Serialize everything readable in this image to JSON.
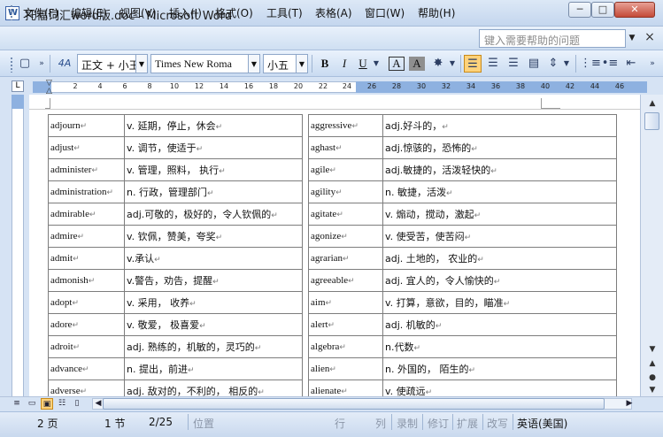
{
  "window": {
    "title": "托福词汇word版.doc - Microsoft Word",
    "minimize_glyph": "─",
    "maximize_glyph": "□",
    "close_glyph": "✕"
  },
  "menu": {
    "items": [
      "文件(F)",
      "编辑(E)",
      "视图(V)",
      "插入(I)",
      "格式(O)",
      "工具(T)",
      "表格(A)",
      "窗口(W)",
      "帮助(H)"
    ],
    "help_placeholder": "键入需要帮助的问题",
    "close_doc_glyph": "×"
  },
  "toolbar": {
    "style_value": "正文 + 小王",
    "font_value": "Times New Roma",
    "size_value": "小五",
    "bold": "B",
    "italic": "I",
    "underline": "U",
    "char_border": "A",
    "char_shade": "A",
    "styles_icon_text": "4A"
  },
  "ruler": {
    "ticks": [
      "2",
      "4",
      "6",
      "8",
      "10",
      "12",
      "14",
      "16",
      "18",
      "20",
      "22",
      "24",
      "26",
      "28",
      "30",
      "32",
      "34",
      "36",
      "38",
      "40",
      "42",
      "44",
      "46"
    ],
    "tab_selector": "L"
  },
  "table": {
    "rows": [
      {
        "word1": "adjourn",
        "def1": "v. 延期，停止，休会",
        "word2": "aggressive",
        "def2": "adj.好斗的，"
      },
      {
        "word1": "adjust",
        "def1": "v. 调节，使适于",
        "word2": "aghast",
        "def2": "adj.惊骇的，恐怖的"
      },
      {
        "word1": "administer",
        "def1": "v. 管理，照料，  执行",
        "word2": "agile",
        "def2": "adj.敏捷的，活泼轻快的"
      },
      {
        "word1": "administration",
        "def1": "n. 行政，管理部门",
        "word2": "agility",
        "def2": "n. 敏捷，活泼"
      },
      {
        "word1": "admirable",
        "def1": "adj.可敬的，极好的，令人钦佩的",
        "word2": "agitate",
        "def2": "v. 煽动，搅动，激起"
      },
      {
        "word1": "admire",
        "def1": "v. 钦佩，赞美，夸奖",
        "word2": "agonize",
        "def2": "v. 使受苦，使苦闷"
      },
      {
        "word1": "admit",
        "def1": "v.承认",
        "word2": "agrarian",
        "def2": "adj. 土地的，  农业的"
      },
      {
        "word1": "admonish",
        "def1": "v.警告，劝告，提醒",
        "word2": "agreeable",
        "def2": "adj. 宜人的，令人愉快的"
      },
      {
        "word1": "adopt",
        "def1": "v. 采用，  收养",
        "word2": "aim",
        "def2": "v. 打算，意欲，目的，瞄准"
      },
      {
        "word1": "adore",
        "def1": "v. 敬爱，  极喜爱",
        "word2": "alert",
        "def2": "adj. 机敏的"
      },
      {
        "word1": "adroit",
        "def1": "adj. 熟练的，机敏的，灵巧的",
        "word2": "algebra",
        "def2": "n.代数"
      },
      {
        "word1": "advance",
        "def1": "n. 提出，前进",
        "word2": "alien",
        "def2": "n. 外国的，  陌生的"
      },
      {
        "word1": "adverse",
        "def1": "adj. 敌对的，不利的，  相反的",
        "word2": "alienate",
        "def2": "v. 使疏远"
      }
    ],
    "para_mark": "↵"
  },
  "status": {
    "page": "2 页",
    "section": "1 节",
    "pages": "2/25",
    "position": "位置",
    "line": "行",
    "column": "列",
    "record": "录制",
    "revise": "修订",
    "extend": "扩展",
    "overtype": "改写",
    "language": "英语(美国)"
  },
  "colors": {
    "accent": "#ffd27a",
    "frame": "#d6e3f4",
    "ruler_margin": "#8eb1e0"
  }
}
